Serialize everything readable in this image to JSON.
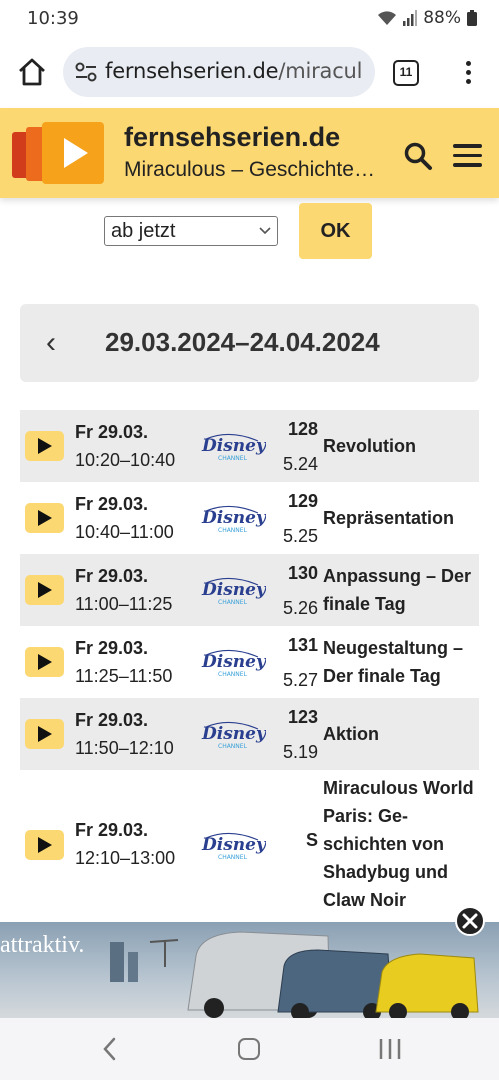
{
  "status_bar": {
    "time": "10:39",
    "battery": "88%"
  },
  "browser": {
    "url_host": "fernsehserien.de",
    "url_path": "/miracul",
    "tab_count": "11"
  },
  "site": {
    "title": "fernsehserien.de",
    "subtitle": "Miraculous – Geschichten von Ladybug und Cat Noir"
  },
  "filter": {
    "selected": "ab jetzt",
    "ok_label": "OK"
  },
  "date_range": {
    "prev_symbol": "‹",
    "label": "29.03.2024–24.04.2024"
  },
  "channel_name": "Disney Channel",
  "episodes": [
    {
      "day": "Fr 29.03.",
      "time": "10:20–10:40",
      "number": "128",
      "code": "5.24",
      "title": "Revolution"
    },
    {
      "day": "Fr 29.03.",
      "time": "10:40–11:00",
      "number": "129",
      "code": "5.25",
      "title": "Repräsentation"
    },
    {
      "day": "Fr 29.03.",
      "time": "11:00–11:25",
      "number": "130",
      "code": "5.26",
      "title": "Anpassung – Der finale Tag"
    },
    {
      "day": "Fr 29.03.",
      "time": "11:25–11:50",
      "number": "131",
      "code": "5.27",
      "title": "Neugestaltung – Der finale Tag"
    },
    {
      "day": "Fr 29.03.",
      "time": "11:50–12:10",
      "number": "123",
      "code": "5.19",
      "title": "Aktion"
    },
    {
      "day": "Fr 29.03.",
      "time": "12:10–13:00",
      "number": "",
      "code": "S",
      "title": "Miraculous World Paris: Ge-schichten von Shadybug und Claw Noir"
    }
  ],
  "ad": {
    "slogan": "attraktiv."
  },
  "colors": {
    "accent": "#fbd872",
    "row_alt": "#ebebeb"
  }
}
